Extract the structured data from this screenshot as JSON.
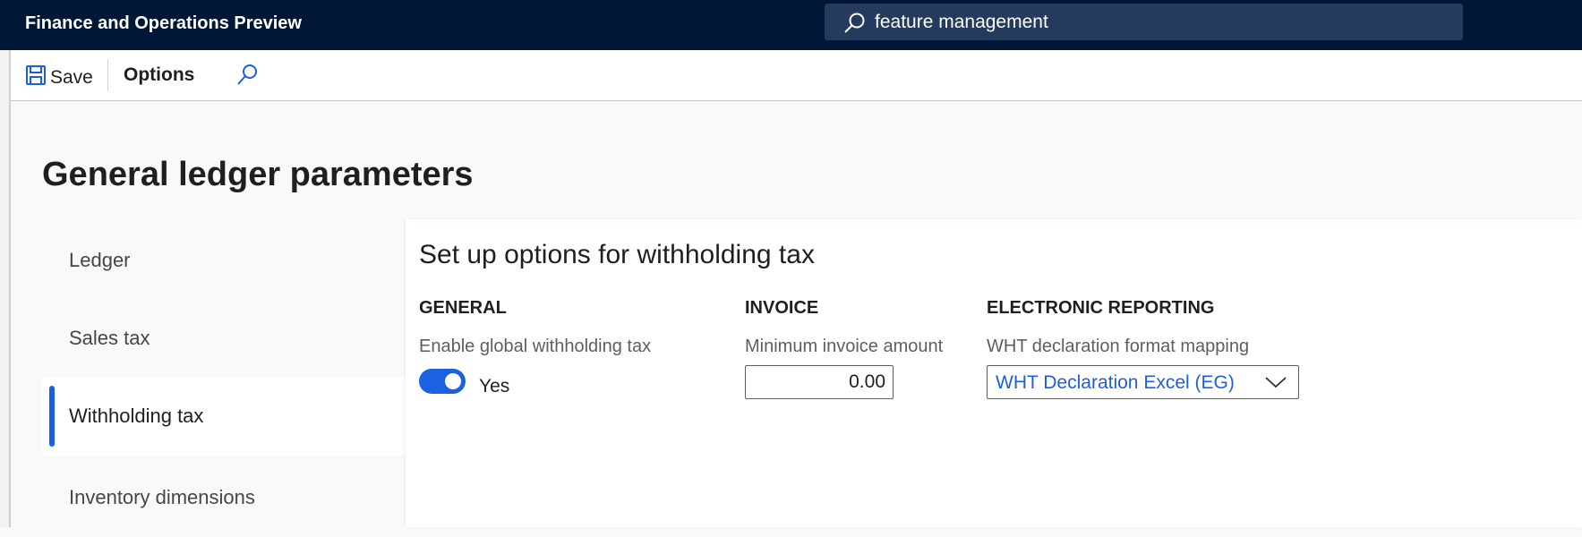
{
  "app": {
    "title": "Finance and Operations Preview",
    "search_value": "feature management"
  },
  "toolbar": {
    "save_label": "Save",
    "options_label": "Options"
  },
  "page": {
    "title": "General ledger parameters"
  },
  "nav": {
    "items": [
      {
        "label": "Ledger"
      },
      {
        "label": "Sales tax"
      },
      {
        "label": "Withholding tax",
        "selected": true
      },
      {
        "label": "Inventory dimensions"
      }
    ]
  },
  "panel": {
    "heading": "Set up options for withholding tax",
    "general": {
      "heading": "GENERAL",
      "label": "Enable global withholding tax",
      "toggle_on": true,
      "toggle_text": "Yes"
    },
    "invoice": {
      "heading": "INVOICE",
      "label": "Minimum invoice amount",
      "value": "0.00"
    },
    "er": {
      "heading": "ELECTRONIC REPORTING",
      "label": "WHT declaration format mapping",
      "value": "WHT Declaration Excel (EG)"
    }
  },
  "colors": {
    "topbar": "#001737",
    "accent": "#1a62e0"
  }
}
